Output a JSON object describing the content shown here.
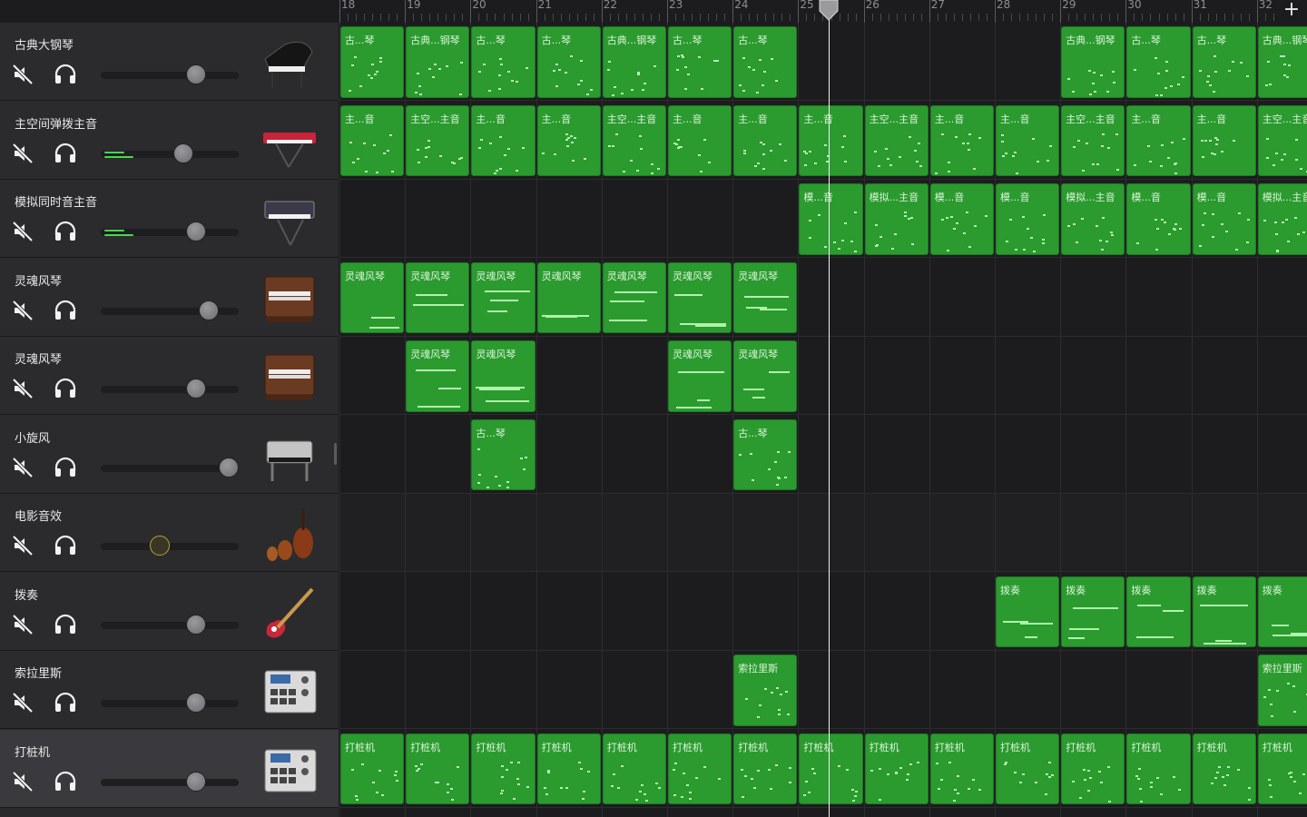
{
  "colors": {
    "region_fill": "#2b9a2f",
    "note": "#aef5a8",
    "meter": "#47d94c",
    "playhead": "#f2f2f2",
    "knob_active": "#b8a238"
  },
  "ruler": {
    "bars": [
      "18",
      "19",
      "20",
      "21",
      "22",
      "23",
      "24",
      "25",
      "26",
      "27",
      "28",
      "29",
      "30",
      "31",
      "32"
    ],
    "add_label": "+"
  },
  "icons": {
    "mute": "speaker-muted-icon",
    "solo": "headphones-icon",
    "add": "plus-icon"
  },
  "tracks": [
    {
      "name": "古典大钢琴",
      "volume": 0.69,
      "meter": 0,
      "instrument": "grand-piano-icon",
      "selected": false
    },
    {
      "name": "主空间弹拨主音",
      "volume": 0.6,
      "meter": 1,
      "instrument": "red-synth-keyboard-icon",
      "selected": false
    },
    {
      "name": "模拟同时音主音",
      "volume": 0.69,
      "meter": 1,
      "instrument": "analog-synth-icon",
      "selected": false
    },
    {
      "name": "灵魂风琴",
      "volume": 0.78,
      "meter": 0,
      "instrument": "organ-icon",
      "selected": false
    },
    {
      "name": "灵魂风琴",
      "volume": 0.69,
      "meter": 0,
      "instrument": "organ-icon",
      "selected": false
    },
    {
      "name": "小旋风",
      "volume": 0.93,
      "meter": 0,
      "instrument": "electric-piano-icon",
      "selected": false
    },
    {
      "name": "电影音效",
      "volume": 0.43,
      "meter": 0,
      "instrument": "orchestra-strings-icon",
      "selected": false,
      "active_knob": true
    },
    {
      "name": "拨奏",
      "volume": 0.69,
      "meter": 0,
      "instrument": "bass-guitar-icon",
      "selected": false
    },
    {
      "name": "索拉里斯",
      "volume": 0.69,
      "meter": 0,
      "instrument": "drum-machine-icon",
      "selected": false
    },
    {
      "name": "打桩机",
      "volume": 0.69,
      "meter": 0,
      "instrument": "drum-machine-icon",
      "selected": true
    }
  ],
  "regions": [
    {
      "track": 0,
      "bars": [
        18,
        19,
        20,
        21,
        22,
        23,
        24
      ],
      "labels": [
        "古...琴",
        "古典...钢琴",
        "古...琴",
        "古...琴",
        "古典...钢琴",
        "古...琴",
        "古...琴"
      ]
    },
    {
      "track": 0,
      "bars": [
        29,
        30,
        31,
        32
      ],
      "labels": [
        "古典...钢琴",
        "古...琴",
        "古...琴",
        "古典...钢琴"
      ]
    },
    {
      "track": 1,
      "bars": [
        18,
        19,
        20,
        21,
        22,
        23,
        24,
        25,
        26,
        27,
        28,
        29,
        30,
        31,
        32
      ],
      "labels": [
        "主...音",
        "主空...主音",
        "主...音",
        "主...音",
        "主空...主音",
        "主...音",
        "主...音",
        "主...音",
        "主空...主音",
        "主...音",
        "主...音",
        "主空...主音",
        "主...音",
        "主...音",
        "主空...主音"
      ]
    },
    {
      "track": 2,
      "bars": [
        25,
        26,
        27,
        28,
        29,
        30,
        31,
        32
      ],
      "labels": [
        "模...音",
        "模拟...主音",
        "模...音",
        "模...音",
        "模拟...主音",
        "模...音",
        "模...音",
        "模拟...主音"
      ]
    },
    {
      "track": 3,
      "bars": [
        18,
        19,
        20,
        21,
        22,
        23,
        24
      ],
      "labels": [
        "灵魂风琴",
        "灵魂风琴",
        "灵魂风琴",
        "灵魂风琴",
        "灵魂风琴",
        "灵魂风琴",
        "灵魂风琴"
      ]
    },
    {
      "track": 4,
      "bars": [
        19,
        20
      ],
      "labels": [
        "灵魂风琴",
        "灵魂风琴"
      ]
    },
    {
      "track": 4,
      "bars": [
        23,
        24
      ],
      "labels": [
        "灵魂风琴",
        "灵魂风琴"
      ]
    },
    {
      "track": 5,
      "bars": [
        20
      ],
      "labels": [
        "古...琴"
      ]
    },
    {
      "track": 5,
      "bars": [
        24
      ],
      "labels": [
        "古...琴"
      ]
    },
    {
      "track": 7,
      "bars": [
        28,
        29,
        30,
        31,
        32
      ],
      "labels": [
        "拨奏",
        "拨奏",
        "拨奏",
        "拨奏",
        "拨奏"
      ]
    },
    {
      "track": 8,
      "bars": [
        24
      ],
      "labels": [
        "索拉里斯"
      ]
    },
    {
      "track": 8,
      "bars": [
        32
      ],
      "labels": [
        "索拉里斯"
      ]
    },
    {
      "track": 9,
      "bars": [
        18,
        19,
        20,
        21,
        22,
        23,
        24,
        25,
        26,
        27,
        28,
        29,
        30,
        31,
        32
      ],
      "labels": [
        "打桩机",
        "打桩机",
        "打桩机",
        "打桩机",
        "打桩机",
        "打桩机",
        "打桩机",
        "打桩机",
        "打桩机",
        "打桩机",
        "打桩机",
        "打桩机",
        "打桩机",
        "打桩机",
        "打桩机"
      ]
    }
  ],
  "playhead_bar": 25.47
}
